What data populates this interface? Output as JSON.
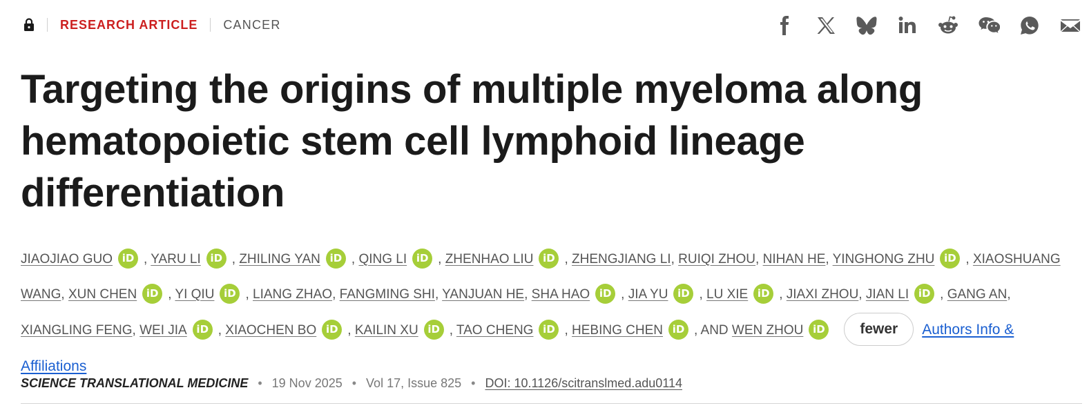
{
  "header": {
    "article_type": "RESEARCH ARTICLE",
    "subject": "CANCER"
  },
  "share_icons": [
    "facebook-icon",
    "x-twitter-icon",
    "bluesky-icon",
    "linkedin-icon",
    "reddit-icon",
    "wechat-icon",
    "whatsapp-icon",
    "email-icon"
  ],
  "title": "Targeting the origins of multiple myeloma along hematopoietic stem cell lymphoid lineage differentiation",
  "authors": {
    "list": [
      {
        "name": "JIAOJIAO GUO",
        "orcid": true
      },
      {
        "name": "YARU LI",
        "orcid": true
      },
      {
        "name": "ZHILING YAN",
        "orcid": true
      },
      {
        "name": "QING LI",
        "orcid": true
      },
      {
        "name": "ZHENHAO LIU",
        "orcid": true
      },
      {
        "name": "ZHENGJIANG LI",
        "orcid": false
      },
      {
        "name": "RUIQI ZHOU",
        "orcid": false
      },
      {
        "name": "NIHAN HE",
        "orcid": false
      },
      {
        "name": "YINGHONG ZHU",
        "orcid": true
      },
      {
        "name": "XIAOSHUANG WANG",
        "orcid": false
      },
      {
        "name": "XUN CHEN",
        "orcid": true
      },
      {
        "name": "YI QIU",
        "orcid": true
      },
      {
        "name": "LIANG ZHAO",
        "orcid": false
      },
      {
        "name": "FANGMING SHI",
        "orcid": false
      },
      {
        "name": "YANJUAN HE",
        "orcid": false
      },
      {
        "name": "SHA HAO",
        "orcid": true
      },
      {
        "name": "JIA YU",
        "orcid": true
      },
      {
        "name": "LU XIE",
        "orcid": true
      },
      {
        "name": "JIAXI ZHOU",
        "orcid": false
      },
      {
        "name": "JIAN LI",
        "orcid": true
      },
      {
        "name": "GANG AN",
        "orcid": false
      },
      {
        "name": "XIANGLING FENG",
        "orcid": false
      },
      {
        "name": "WEI JIA",
        "orcid": true
      },
      {
        "name": "XIAOCHEN BO",
        "orcid": true
      },
      {
        "name": "KAILIN XU",
        "orcid": true
      },
      {
        "name": "TAO CHENG",
        "orcid": true
      },
      {
        "name": "HEBING CHEN",
        "orcid": true
      },
      {
        "name": "WEN ZHOU",
        "orcid": true
      }
    ],
    "and_word": "AND",
    "orcid_label": "iD",
    "fewer_label": "fewer",
    "affiliations_label": "Authors Info & Affiliations"
  },
  "meta": {
    "journal": "SCIENCE TRANSLATIONAL MEDICINE",
    "date": "19 Nov 2025",
    "volume_issue": "Vol 17, Issue 825",
    "doi": "DOI: 10.1126/scitranslmed.adu0114",
    "separator": "•"
  },
  "colors": {
    "article_type": "#cc1f1f",
    "orcid": "#a6ce39",
    "link": "#1a5fd1",
    "icon": "#5a5a5a"
  }
}
